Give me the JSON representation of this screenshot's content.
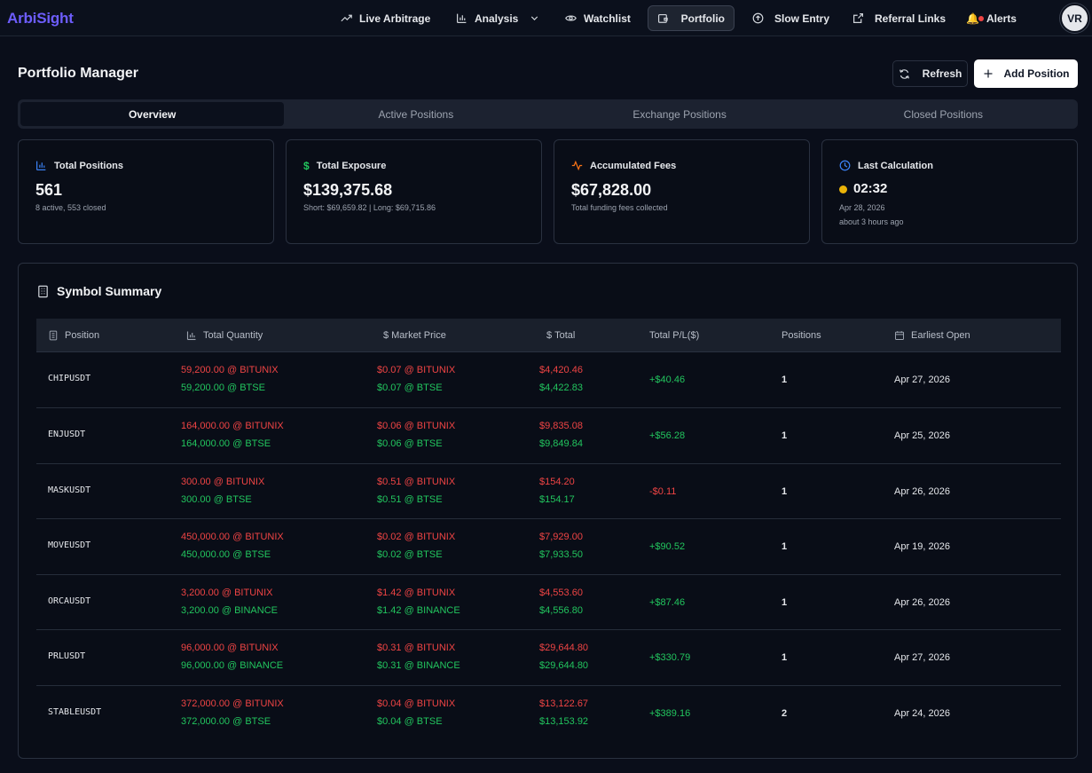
{
  "nav": {
    "logo": "ArbiSight",
    "items": [
      {
        "label": "Live Arbitrage",
        "icon": "trending-up-icon"
      },
      {
        "label": "Analysis",
        "icon": "bar-chart-icon"
      },
      {
        "label": "Watchlist",
        "icon": "eye-icon"
      },
      {
        "label": "Portfolio",
        "icon": "wallet-icon",
        "active": true
      },
      {
        "label": "Slow Entry",
        "icon": "arrow-up-circle-icon"
      },
      {
        "label": "Referral Links",
        "icon": "external-link-icon"
      },
      {
        "label": "Alerts",
        "icon": "bell-icon"
      }
    ],
    "avatar": "VR"
  },
  "page": {
    "title": "Portfolio Manager",
    "refresh_label": "Refresh",
    "add_label": "Add Position"
  },
  "tabs": [
    "Overview",
    "Active Positions",
    "Exchange Positions",
    "Closed Positions"
  ],
  "cards": {
    "total_positions": {
      "label": "Total Positions",
      "value": "561",
      "sub": "8 active, 553 closed"
    },
    "total_exposure": {
      "label": "Total Exposure",
      "value": "$139,375.68",
      "sub": "Short: $69,659.82 | Long: $69,715.86"
    },
    "accumulated_fees": {
      "label": "Accumulated Fees",
      "value": "$67,828.00",
      "sub": "Total funding fees collected"
    },
    "last_calculation": {
      "label": "Last Calculation",
      "value": "02:32",
      "sub": "Apr 28, 2026",
      "sub2": "about 3 hours ago"
    }
  },
  "summary": {
    "title": "Symbol Summary",
    "columns": [
      "Position",
      "Total Quantity",
      "Market Price",
      "Total",
      "Total P/L($)",
      "Positions",
      "Earliest Open"
    ],
    "rows": [
      {
        "symbol": "CHIPUSDT",
        "qty1": "59,200.00 @ BITUNIX",
        "qty2": "59,200.00 @ BTSE",
        "price1": "$0.07 @ BITUNIX",
        "price2": "$0.07 @ BTSE",
        "total1": "$4,420.46",
        "total2": "$4,422.83",
        "pl": "+$40.46",
        "pl_positive": true,
        "positions": "1",
        "open": "Apr 27, 2026"
      },
      {
        "symbol": "ENJUSDT",
        "qty1": "164,000.00 @ BITUNIX",
        "qty2": "164,000.00 @ BTSE",
        "price1": "$0.06 @ BITUNIX",
        "price2": "$0.06 @ BTSE",
        "total1": "$9,835.08",
        "total2": "$9,849.84",
        "pl": "+$56.28",
        "pl_positive": true,
        "positions": "1",
        "open": "Apr 25, 2026"
      },
      {
        "symbol": "MASKUSDT",
        "qty1": "300.00 @ BITUNIX",
        "qty2": "300.00 @ BTSE",
        "price1": "$0.51 @ BITUNIX",
        "price2": "$0.51 @ BTSE",
        "total1": "$154.20",
        "total2": "$154.17",
        "pl": "-$0.11",
        "pl_positive": false,
        "positions": "1",
        "open": "Apr 26, 2026"
      },
      {
        "symbol": "MOVEUSDT",
        "qty1": "450,000.00 @ BITUNIX",
        "qty2": "450,000.00 @ BTSE",
        "price1": "$0.02 @ BITUNIX",
        "price2": "$0.02 @ BTSE",
        "total1": "$7,929.00",
        "total2": "$7,933.50",
        "pl": "+$90.52",
        "pl_positive": true,
        "positions": "1",
        "open": "Apr 19, 2026"
      },
      {
        "symbol": "ORCAUSDT",
        "qty1": "3,200.00 @ BITUNIX",
        "qty2": "3,200.00 @ BINANCE",
        "price1": "$1.42 @ BITUNIX",
        "price2": "$1.42 @ BINANCE",
        "total1": "$4,553.60",
        "total2": "$4,556.80",
        "pl": "+$87.46",
        "pl_positive": true,
        "positions": "1",
        "open": "Apr 26, 2026"
      },
      {
        "symbol": "PRLUSDT",
        "qty1": "96,000.00 @ BITUNIX",
        "qty2": "96,000.00 @ BINANCE",
        "price1": "$0.31 @ BITUNIX",
        "price2": "$0.31 @ BINANCE",
        "total1": "$29,644.80",
        "total2": "$29,644.80",
        "pl": "+$330.79",
        "pl_positive": true,
        "positions": "1",
        "open": "Apr 27, 2026"
      },
      {
        "symbol": "STABLEUSDT",
        "qty1": "372,000.00 @ BITUNIX",
        "qty2": "372,000.00 @ BTSE",
        "price1": "$0.04 @ BITUNIX",
        "price2": "$0.04 @ BTSE",
        "total1": "$13,122.67",
        "total2": "$13,153.92",
        "pl": "+$389.16",
        "pl_positive": true,
        "positions": "2",
        "open": "Apr 24, 2026"
      }
    ]
  },
  "colors": {
    "accent": "#6d5dfc",
    "negative": "#ef4444",
    "positive": "#22c55e",
    "warning": "#eab308"
  }
}
